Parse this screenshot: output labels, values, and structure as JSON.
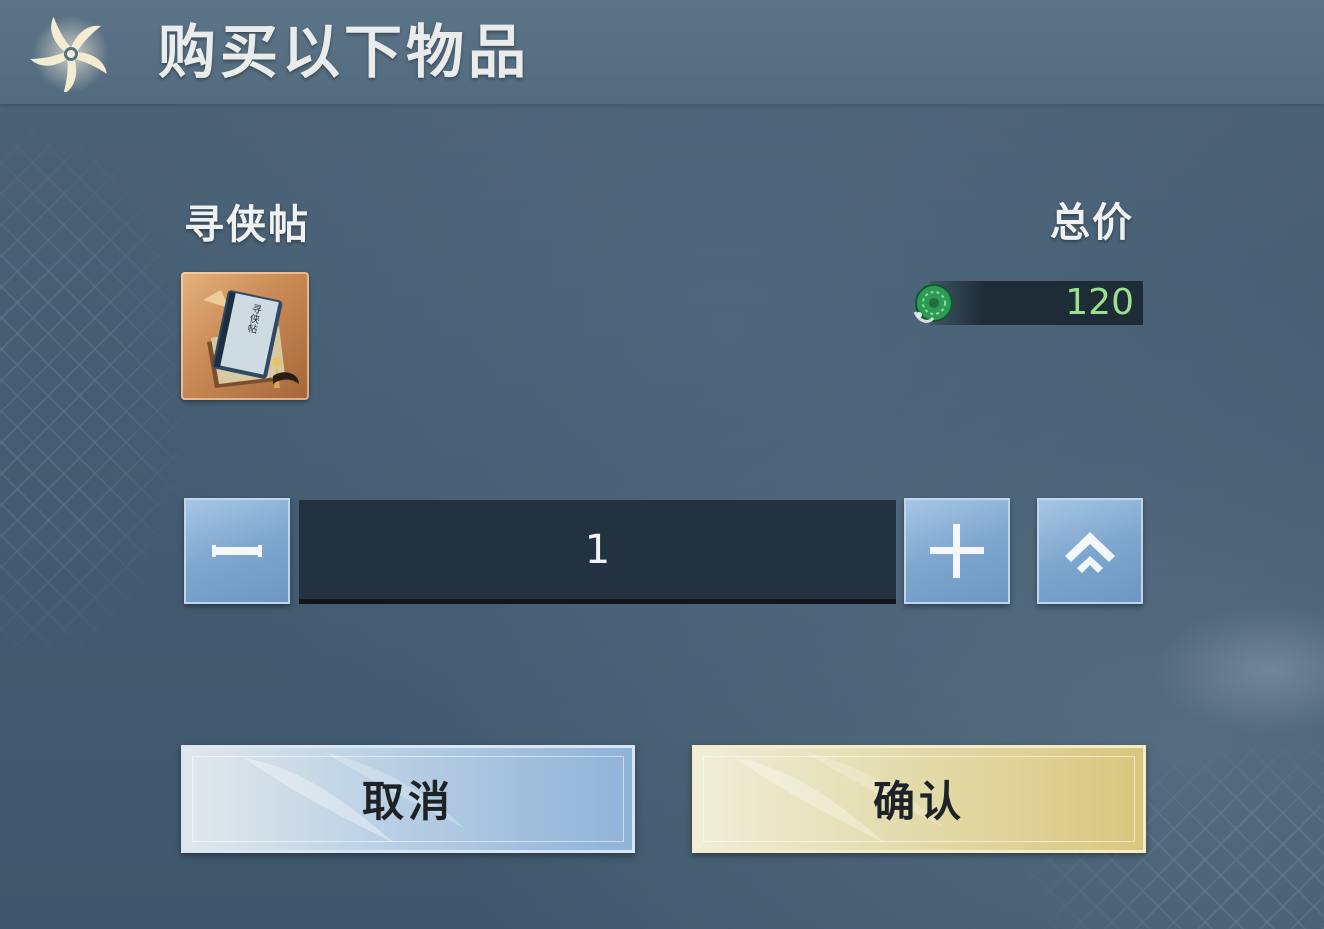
{
  "dialog": {
    "title": "购买以下物品",
    "logo_icon": "pinwheel-logo-icon"
  },
  "item": {
    "name": "寻侠帖",
    "icon": "book-scroll-icon",
    "icon_text": "寻侠帖"
  },
  "price": {
    "label": "总价",
    "currency_icon": "jade-coin-icon",
    "value": "120",
    "value_color": "#9be08c"
  },
  "quantity": {
    "value": "1",
    "decrease_icon": "minus-icon",
    "increase_icon": "plus-icon",
    "max_icon": "double-chevron-up-icon"
  },
  "buttons": {
    "cancel": "取消",
    "confirm": "确认"
  },
  "colors": {
    "cancel_button": "#8fb3d8",
    "confirm_button": "#d9c77e",
    "stepper_button": "#7ea7cf"
  }
}
